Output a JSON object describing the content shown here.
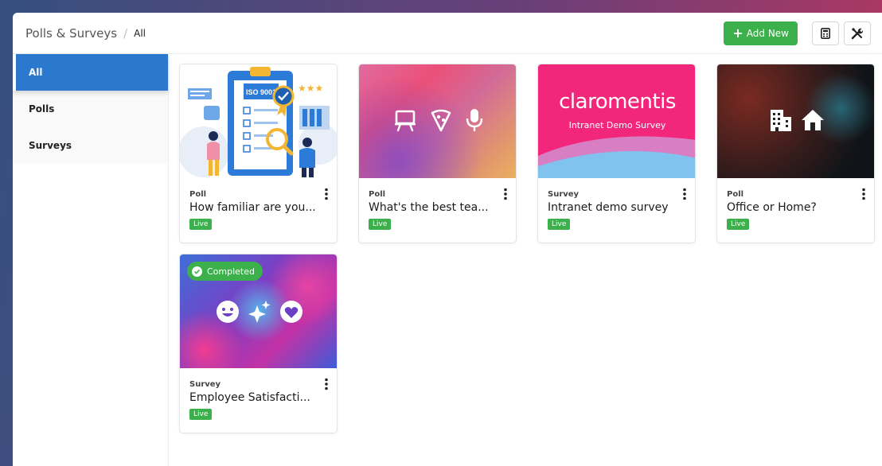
{
  "breadcrumb": {
    "root": "Polls & Surveys",
    "separator": "/",
    "current": "All"
  },
  "toolbar": {
    "add_label": "Add New",
    "add_icon": "plus-icon",
    "icon_buttons": [
      "calculator-icon",
      "tools-icon"
    ]
  },
  "sidebar": {
    "items": [
      {
        "label": "All",
        "active": true
      },
      {
        "label": "Polls",
        "active": false
      },
      {
        "label": "Surveys",
        "active": false
      }
    ]
  },
  "cards": [
    {
      "type": "Poll",
      "title": "How familiar are you...",
      "status": "Live",
      "image": "iso-9001-clipboard",
      "badge_text": "ISO 9001"
    },
    {
      "type": "Poll",
      "title": "What's the best tea...",
      "status": "Live",
      "image": "presentation-pizza-microphone"
    },
    {
      "type": "Survey",
      "title": "Intranet demo survey",
      "status": "Live",
      "image": "claromentis-banner",
      "logo_text": "claromentis",
      "logo_subtitle": "Intranet Demo Survey"
    },
    {
      "type": "Poll",
      "title": "Office or Home?",
      "status": "Live",
      "image": "office-home"
    },
    {
      "type": "Survey",
      "title": "Employee Satisfacti...",
      "status": "Live",
      "image": "smile-sparkle-heart",
      "overlay": "Completed"
    }
  ],
  "colors": {
    "accent_blue": "#2b78cf",
    "success_green": "#3cb04b",
    "brand_pink": "#f2277b"
  }
}
